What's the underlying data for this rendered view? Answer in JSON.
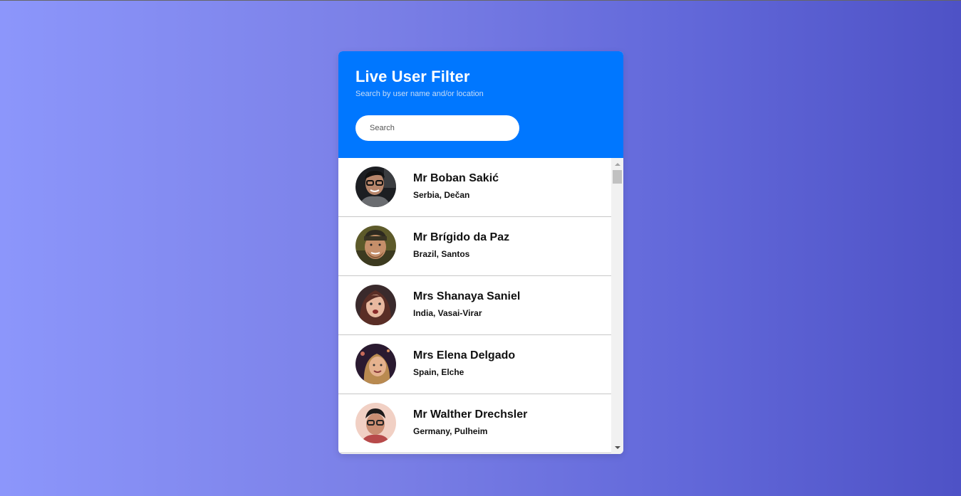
{
  "header": {
    "title": "Live User Filter",
    "subtitle": "Search by user name and/or location"
  },
  "search": {
    "placeholder": "Search",
    "value": ""
  },
  "colors": {
    "header_bg": "#0077ff",
    "bg_gradient_start": "#8c96fb",
    "bg_gradient_end": "#4e52c6"
  },
  "users": [
    {
      "name": "Mr Boban Sakić",
      "location": "Serbia, Dečan",
      "avatar_icon": "user-avatar-photo"
    },
    {
      "name": "Mr Brígido da Paz",
      "location": "Brazil, Santos",
      "avatar_icon": "user-avatar-photo"
    },
    {
      "name": "Mrs Shanaya Saniel",
      "location": "India, Vasai-Virar",
      "avatar_icon": "user-avatar-photo"
    },
    {
      "name": "Mrs Elena Delgado",
      "location": "Spain, Elche",
      "avatar_icon": "user-avatar-photo"
    },
    {
      "name": "Mr Walther Drechsler",
      "location": "Germany, Pulheim",
      "avatar_icon": "user-avatar-photo"
    }
  ]
}
